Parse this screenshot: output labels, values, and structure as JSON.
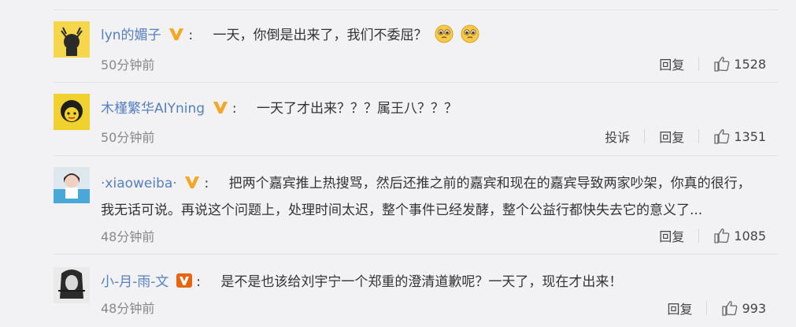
{
  "comments": [
    {
      "username": "lyn的媚子",
      "colon": ":",
      "text": "一天，你倒是出来了，我们不委屈？",
      "time": "50分钟前",
      "reply": "回复",
      "likes": "1528",
      "emojis": [
        "pleading-face-emoji",
        "pleading-face-emoji"
      ],
      "badge_color": "#f5a623"
    },
    {
      "username": "木槿繁华AIYning",
      "colon": ":",
      "text": "一天了才出来？？？属王八？？？",
      "time": "50分钟前",
      "report": "投诉",
      "reply": "回复",
      "likes": "1351",
      "badge_color": "#f5a623"
    },
    {
      "username": "·xiaoweiba·",
      "colon": ":",
      "text_line1": "把两个嘉宾推上热搜骂，然后还推之前的嘉宾和现在的嘉宾导致两家吵架，你真的很行，",
      "text_line2": "我无话可说。再说这个问题上，处理时间太迟，整个事件已经发酵，整个公益行都快失去它的意义了...",
      "time": "48分钟前",
      "reply": "回复",
      "likes": "1085",
      "badge_color": "#f5a623"
    },
    {
      "username": "小-月-雨-文",
      "colon": ":",
      "text": "是不是也该给刘宇宁一个郑重的澄清道歉呢？一天了，现在才出来！",
      "time": "48分钟前",
      "reply": "回复",
      "likes": "993",
      "badge_color": "#e8650f"
    }
  ],
  "colors": {
    "username": "#567fc2",
    "text": "#333333",
    "time": "#888888",
    "background": "#f2f2f5"
  },
  "icons": {
    "like": "thumbs-up-icon",
    "verified": "verified-v-icon"
  }
}
